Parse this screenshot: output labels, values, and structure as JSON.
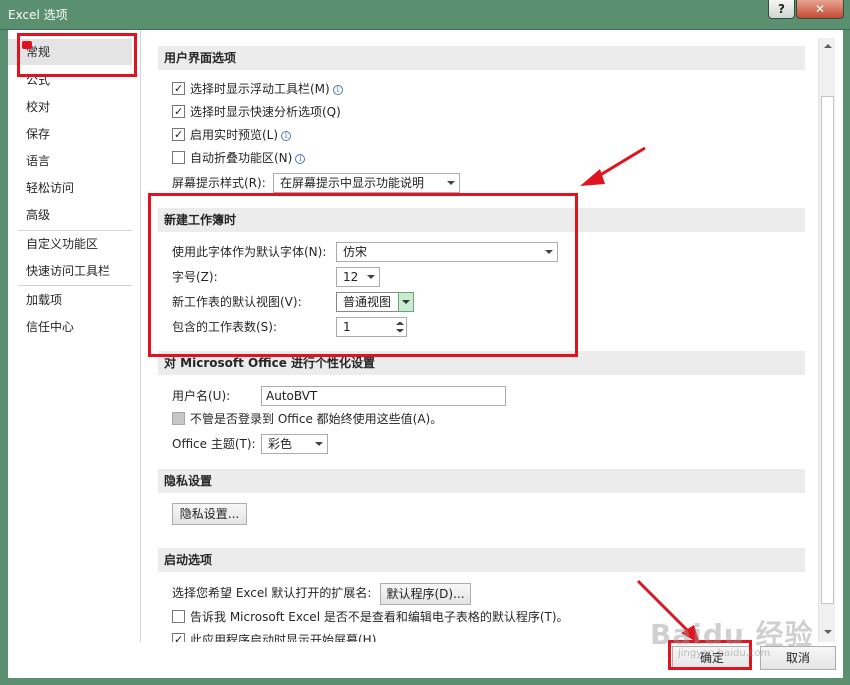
{
  "window": {
    "title": "Excel 选项",
    "help_label": "?",
    "close_label": "✕"
  },
  "sidebar": {
    "items": [
      {
        "label": "常规"
      },
      {
        "label": "公式"
      },
      {
        "label": "校对"
      },
      {
        "label": "保存"
      },
      {
        "label": "语言"
      },
      {
        "label": "轻松访问"
      },
      {
        "label": "高级"
      },
      {
        "label": "自定义功能区"
      },
      {
        "label": "快速访问工具栏"
      },
      {
        "label": "加载项"
      },
      {
        "label": "信任中心"
      }
    ],
    "selected": "常规"
  },
  "ui_options": {
    "header": "用户界面选项",
    "mini_toolbar": "选择时显示浮动工具栏(M)",
    "mini_toolbar_checked": true,
    "quick_analysis": "选择时显示快速分析选项(Q)",
    "quick_analysis_checked": true,
    "live_preview": "启用实时预览(L)",
    "live_preview_checked": true,
    "collapse_ribbon": "自动折叠功能区(N)",
    "collapse_ribbon_checked": false,
    "screentip_label": "屏幕提示样式(R):",
    "screentip_value": "在屏幕提示中显示功能说明"
  },
  "new_workbook": {
    "header": "新建工作簿时",
    "font_label": "使用此字体作为默认字体(N):",
    "font_value": "仿宋",
    "size_label": "字号(Z):",
    "size_value": "12",
    "view_label": "新工作表的默认视图(V):",
    "view_value": "普通视图",
    "sheets_label": "包含的工作表数(S):",
    "sheets_value": "1"
  },
  "personalize": {
    "header": "对 Microsoft Office 进行个性化设置",
    "username_label": "用户名(U):",
    "username_value": "AutoBVT",
    "always_use": "不管是否登录到 Office 都始终使用这些值(A)。",
    "always_use_checked": false,
    "theme_label": "Office 主题(T):",
    "theme_value": "彩色"
  },
  "privacy": {
    "header": "隐私设置",
    "button": "隐私设置..."
  },
  "startup": {
    "header": "启动选项",
    "ext_label": "选择您希望 Excel 默认打开的扩展名:",
    "ext_button": "默认程序(D)...",
    "tell_me": "告诉我 Microsoft Excel 是否不是查看和编辑电子表格的默认程序(T)。",
    "tell_me_checked": false,
    "show_start": "此应用程序启动时显示开始屏幕(H)",
    "show_start_checked": true
  },
  "footer": {
    "ok": "确定",
    "cancel": "取消"
  },
  "watermark": {
    "text": "Baidu 经验",
    "sub": "jingyan.baidu.com"
  },
  "colors": {
    "title_bar": "#5a9070",
    "annotation_red": "#e0141e",
    "section_header": "#ececec"
  }
}
